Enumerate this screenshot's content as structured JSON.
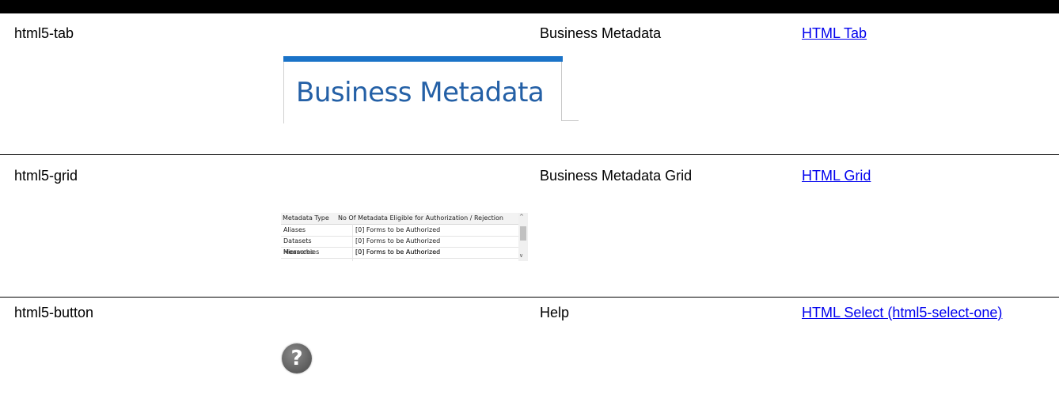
{
  "rows": [
    {
      "id": "html5-tab",
      "label": "Business Metadata",
      "link": "HTML Tab",
      "image_text": "Business Metadata"
    },
    {
      "id": "html5-grid",
      "label": "Business Metadata Grid",
      "link": "HTML Grid",
      "grid": {
        "headers": [
          "Metadata Type",
          "No Of Metadata Eligible for Authorization / Rejection"
        ],
        "rows": [
          [
            "Aliases",
            "[0] Forms to be Authorized"
          ],
          [
            "Datasets",
            "[0] Forms to be Authorized"
          ],
          [
            "Measures",
            "[0] Forms to be Authorized"
          ],
          [
            "Hierarchies",
            "[0] Forms to be Authorized"
          ]
        ]
      }
    },
    {
      "id": "html5-button",
      "label": "Help",
      "link": "HTML Select (html5-select-one)",
      "icon": "help-icon"
    }
  ]
}
